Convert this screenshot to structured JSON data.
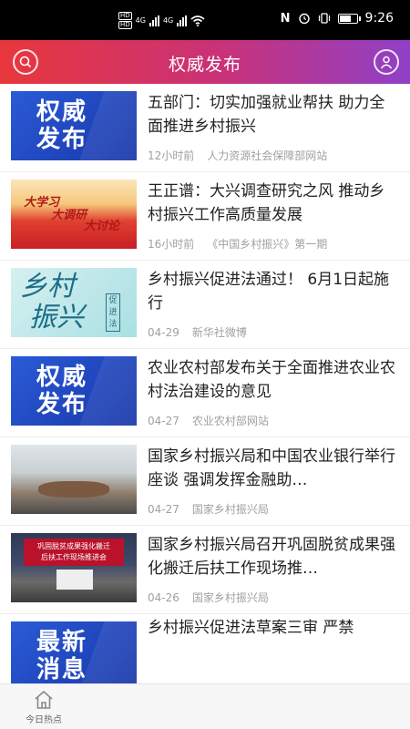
{
  "status_bar": {
    "time": "9:26",
    "network": [
      "4G",
      "4G"
    ],
    "hd_badges": [
      "HD",
      "HD"
    ],
    "icons": [
      "nfc-icon",
      "alarm-icon",
      "vibrate-icon",
      "battery-icon",
      "wifi-icon"
    ]
  },
  "header": {
    "title": "权威发布",
    "accent_colors": [
      "#e8373c",
      "#c8327a",
      "#8f40c8"
    ]
  },
  "news": [
    {
      "title": "五部门：切实加强就业帮扶 助力全面推进乡村振兴",
      "time": "12小时前",
      "source": "人力资源社会保障部网站",
      "thumb_type": "blue",
      "thumb_text": [
        "权威",
        "发布"
      ]
    },
    {
      "title": "王正谱：大兴调查研究之风 推动乡村振兴工作高质量发展",
      "time": "16小时前",
      "source": "《中国乡村振兴》第一期",
      "thumb_type": "red",
      "thumb_text": [
        "大学习",
        "大调研",
        "大讨论"
      ]
    },
    {
      "title": "乡村振兴促进法通过！ 6月1日起施行",
      "time": "04-29",
      "source": "新华社微博",
      "thumb_type": "teal",
      "thumb_text": [
        "乡村",
        "振兴",
        "促进法"
      ]
    },
    {
      "title": "农业农村部发布关于全面推进农业农村法治建设的意见",
      "time": "04-27",
      "source": "农业农村部网站",
      "thumb_type": "blue",
      "thumb_text": [
        "权威",
        "发布"
      ]
    },
    {
      "title": "国家乡村振兴局和中国农业银行举行座谈 强调发挥金融助…",
      "time": "04-27",
      "source": "国家乡村振兴局",
      "thumb_type": "photo1",
      "thumb_text": []
    },
    {
      "title": "国家乡村振兴局召开巩固脱贫成果强化搬迁后扶工作现场推…",
      "time": "04-26",
      "source": "国家乡村振兴局",
      "thumb_type": "photo2",
      "thumb_text": [
        "巩固脱贫成果强化搬迁",
        "后扶工作现场推进会"
      ]
    },
    {
      "title": "乡村振兴促进法草案三审 严禁",
      "time": "",
      "source": "",
      "thumb_type": "blue",
      "thumb_text": [
        "最新",
        "消息"
      ]
    }
  ],
  "tab_bar": {
    "home_label": "今日热点"
  }
}
